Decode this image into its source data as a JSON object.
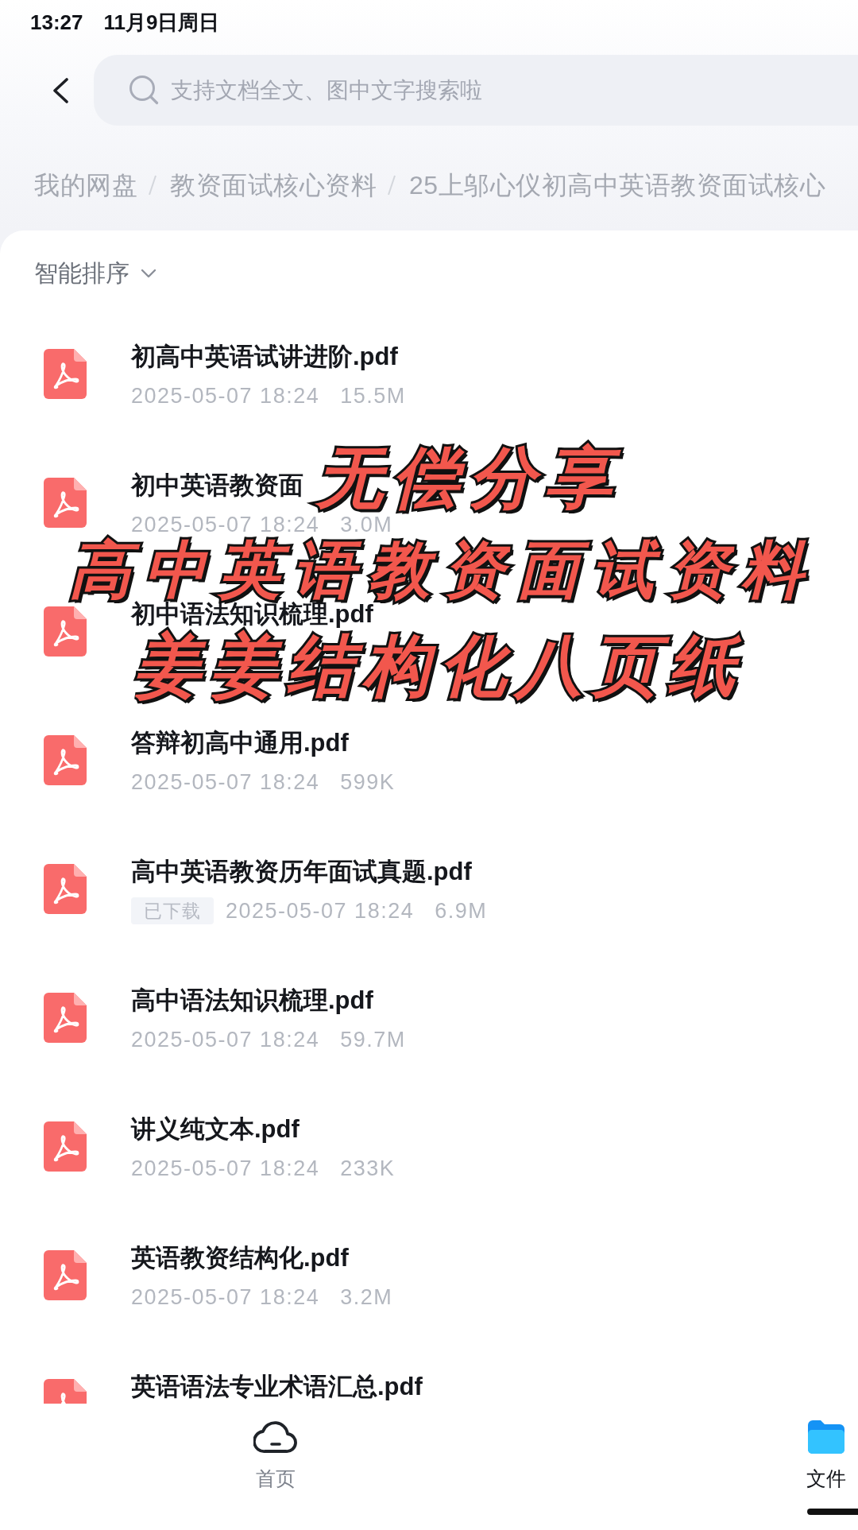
{
  "status_bar": {
    "time": "13:27",
    "date": "11月9日周日"
  },
  "search": {
    "placeholder": "支持文档全文、图中文字搜索啦"
  },
  "breadcrumb": [
    "我的网盘",
    "教资面试核心资料",
    "25上邬心仪初高中英语教资面试核心"
  ],
  "sort": {
    "label": "智能排序"
  },
  "files": [
    {
      "name": "初高中英语试讲进阶.pdf",
      "date": "2025-05-07 18:24",
      "size": "15.5M"
    },
    {
      "name": "初中英语教资面",
      "date": "2025-05-07 18:24",
      "size": "3.0M"
    },
    {
      "name": "初中语法知识梳理.pdf"
    },
    {
      "name": "答辩初高中通用.pdf",
      "date": "2025-05-07 18:24",
      "size": "599K"
    },
    {
      "name": "高中英语教资历年面试真题.pdf",
      "badge": "已下载",
      "date": "2025-05-07 18:24",
      "size": "6.9M"
    },
    {
      "name": "高中语法知识梳理.pdf",
      "date": "2025-05-07 18:24",
      "size": "59.7M"
    },
    {
      "name": "讲义纯文本.pdf",
      "date": "2025-05-07 18:24",
      "size": "233K"
    },
    {
      "name": "英语教资结构化.pdf",
      "date": "2025-05-07 18:24",
      "size": "3.2M"
    },
    {
      "name": "英语语法专业术语汇总.pdf"
    }
  ],
  "overlay": {
    "lines": [
      "无偿分享",
      "高中英语教资面试资料",
      "姜姜结构化八页纸"
    ]
  },
  "nav": [
    {
      "label": "首页",
      "kind": "cloud",
      "selected": false
    },
    {
      "label": "文件",
      "kind": "folder",
      "selected": true
    }
  ]
}
